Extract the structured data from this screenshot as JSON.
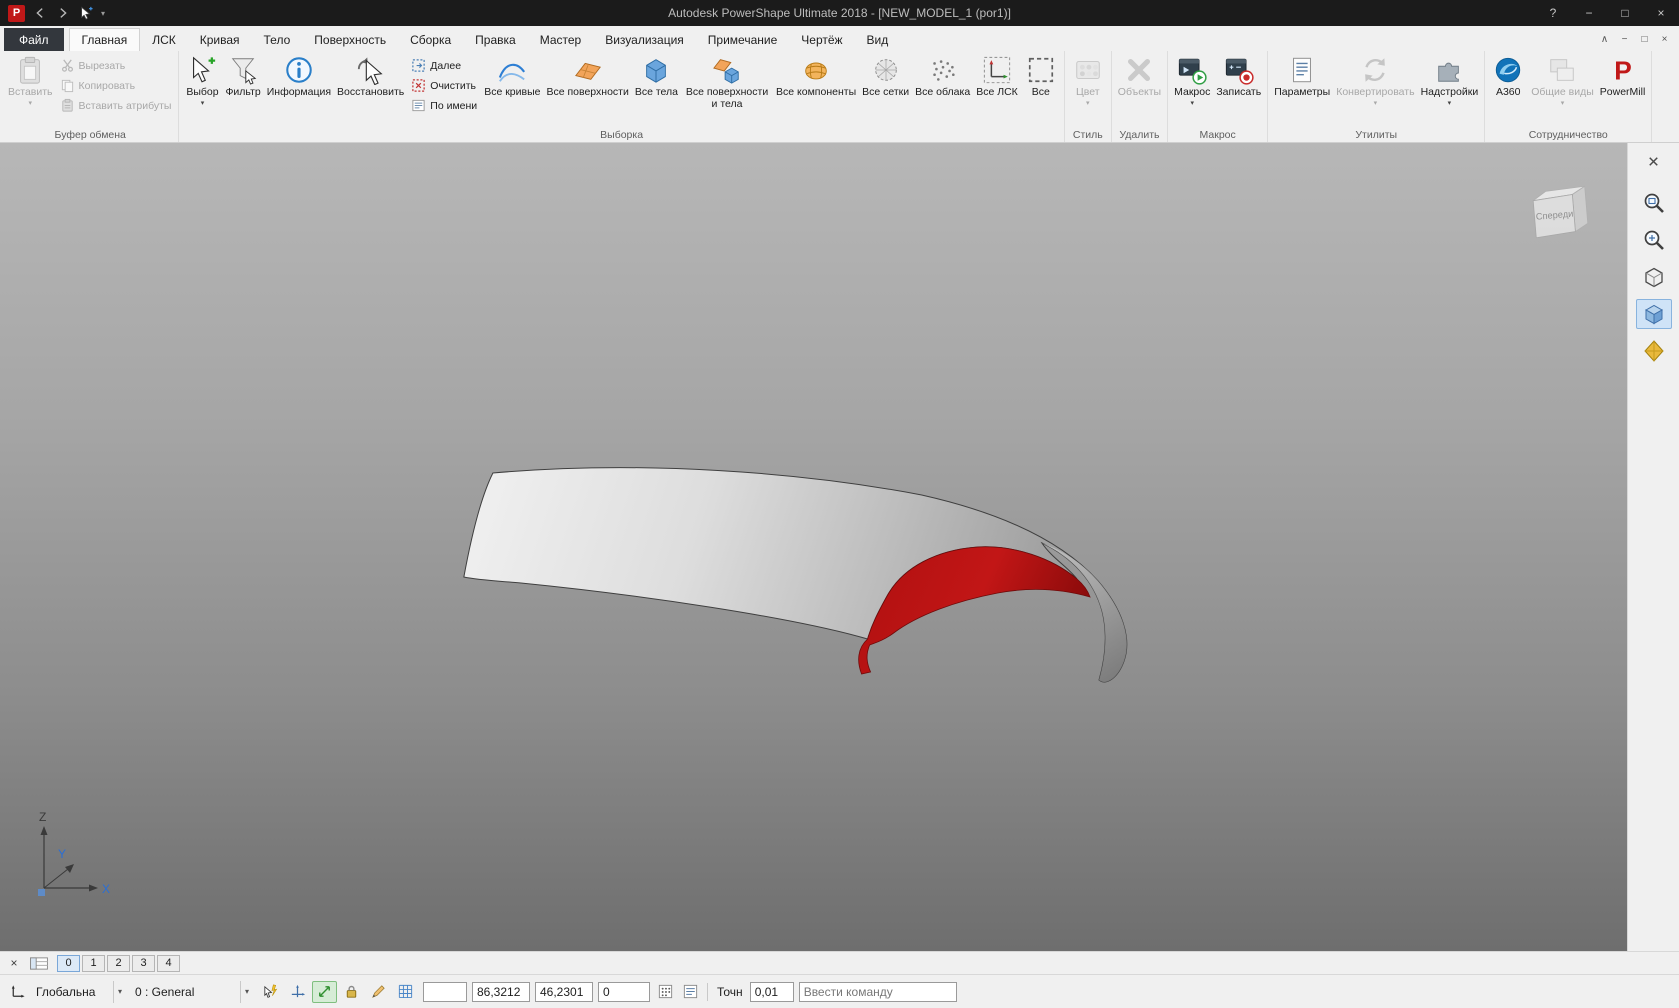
{
  "titlebar": {
    "title": "Autodesk PowerShape Ultimate 2018 - [NEW_MODEL_1 (por1)]",
    "logo_letter": "P",
    "controls": [
      {
        "name": "help-button",
        "glyph": "?"
      },
      {
        "name": "minimize-button",
        "glyph": "−"
      },
      {
        "name": "maximize-button",
        "glyph": "□"
      },
      {
        "name": "close-button",
        "glyph": "×"
      }
    ]
  },
  "tabs": {
    "file": "Файл",
    "active": "Главная",
    "items": [
      "Главная",
      "ЛСК",
      "Кривая",
      "Тело",
      "Поверхность",
      "Сборка",
      "Правка",
      "Мастер",
      "Визуализация",
      "Примечание",
      "Чертёж",
      "Вид"
    ],
    "window_controls": [
      {
        "name": "ribbon-collapse-button",
        "glyph": "∧"
      },
      {
        "name": "doc-minimize-button",
        "glyph": "−"
      },
      {
        "name": "doc-restore-button",
        "glyph": "□"
      },
      {
        "name": "doc-close-button",
        "glyph": "×"
      }
    ]
  },
  "ribbon": {
    "groups": [
      {
        "label": "Буфер обмена",
        "items": [
          {
            "name": "paste-button",
            "label": "Вставить",
            "icon": "paste-icon",
            "size": "big",
            "enabled": false,
            "arrow": true
          },
          {
            "name": "cut-button",
            "label": "Вырезать",
            "icon": "cut-icon",
            "size": "small",
            "enabled": false
          },
          {
            "name": "copy-button",
            "label": "Копировать",
            "icon": "copy-icon",
            "size": "small",
            "enabled": false
          },
          {
            "name": "paste-attributes-button",
            "label": "Вставить атрибуты",
            "icon": "paste-attributes-icon",
            "size": "small",
            "enabled": false
          }
        ]
      },
      {
        "label": "Выборка",
        "items": [
          {
            "name": "select-button",
            "label": "Выбор",
            "icon": "select-icon",
            "size": "big",
            "arrow": true
          },
          {
            "name": "filter-button",
            "label": "Фильтр",
            "icon": "filter-icon",
            "size": "big"
          },
          {
            "name": "info-button",
            "label": "Информация",
            "icon": "info-icon",
            "size": "big"
          },
          {
            "name": "restore-button",
            "label": "Восстановить",
            "icon": "restore-icon",
            "size": "big"
          },
          {
            "name": "next-button",
            "label": "Далее",
            "icon": "next-icon",
            "size": "small"
          },
          {
            "name": "clear-button",
            "label": "Очистить",
            "icon": "clear-icon",
            "size": "small"
          },
          {
            "name": "by-name-button",
            "label": "По имени",
            "icon": "by-name-icon",
            "size": "small"
          },
          {
            "name": "all-curves-button",
            "label": "Все кривые",
            "icon": "all-curves-icon",
            "size": "big"
          },
          {
            "name": "all-surfaces-button",
            "label": "Все поверхности",
            "icon": "all-surfaces-icon",
            "size": "big"
          },
          {
            "name": "all-solids-button",
            "label": "Все тела",
            "icon": "all-solids-icon",
            "size": "big"
          },
          {
            "name": "all-surfaces-solids-button",
            "label": "Все поверхности и тела",
            "icon": "all-surfaces-solids-icon",
            "size": "big"
          },
          {
            "name": "all-components-button",
            "label": "Все компоненты",
            "icon": "all-components-icon",
            "size": "big"
          },
          {
            "name": "all-meshes-button",
            "label": "Все сетки",
            "icon": "all-meshes-icon",
            "size": "big"
          },
          {
            "name": "all-clouds-button",
            "label": "Все облака",
            "icon": "all-clouds-icon",
            "size": "big"
          },
          {
            "name": "all-wcs-button",
            "label": "Все ЛСК",
            "icon": "all-wcs-icon",
            "size": "big"
          },
          {
            "name": "all-button",
            "label": "Все",
            "icon": "all-icon",
            "size": "big"
          }
        ]
      },
      {
        "label": "Стиль",
        "items": [
          {
            "name": "color-button",
            "label": "Цвет",
            "icon": "color-icon",
            "size": "big",
            "enabled": false,
            "arrow": true
          }
        ]
      },
      {
        "label": "Удалить",
        "items": [
          {
            "name": "delete-objects-button",
            "label": "Объекты",
            "icon": "delete-objects-icon",
            "size": "big",
            "enabled": false
          }
        ]
      },
      {
        "label": "Макрос",
        "items": [
          {
            "name": "macro-button",
            "label": "Макрос",
            "icon": "macro-icon",
            "size": "big",
            "arrow": true
          },
          {
            "name": "record-button",
            "label": "Записать",
            "icon": "record-icon",
            "size": "big"
          }
        ]
      },
      {
        "label": "Утилиты",
        "items": [
          {
            "name": "parameters-button",
            "label": "Параметры",
            "icon": "parameters-icon",
            "size": "big"
          },
          {
            "name": "convert-button",
            "label": "Конвертировать",
            "icon": "convert-icon",
            "size": "big",
            "enabled": false,
            "arrow": true
          },
          {
            "name": "addins-button",
            "label": "Надстройки",
            "icon": "addins-icon",
            "size": "big",
            "arrow": true
          }
        ]
      },
      {
        "label": "Сотрудничество",
        "items": [
          {
            "name": "a360-button",
            "label": "A360",
            "icon": "a360-icon",
            "size": "big"
          },
          {
            "name": "shared-views-button",
            "label": "Общие виды",
            "icon": "shared-views-icon",
            "size": "big",
            "enabled": false,
            "arrow": true
          },
          {
            "name": "powermill-button",
            "label": "PowerMill",
            "icon": "powermill-icon",
            "size": "big"
          }
        ]
      }
    ]
  },
  "viewport": {
    "viewcube_label": "Спереди",
    "axis_labels": {
      "x": "X",
      "y": "Y",
      "z": "Z"
    }
  },
  "right_toolbar": {
    "items": [
      {
        "name": "viewport-close-button",
        "icon": "close-x-icon",
        "first": true
      },
      {
        "name": "zoom-window-button",
        "icon": "zoom-window-icon"
      },
      {
        "name": "zoom-button",
        "icon": "zoom-icon"
      },
      {
        "name": "wireframe-view-button",
        "icon": "wireframe-cube-icon"
      },
      {
        "name": "shaded-view-button",
        "icon": "shaded-cube-icon",
        "active": true
      },
      {
        "name": "render-style-button",
        "icon": "render-style-icon"
      }
    ]
  },
  "levels_bar": {
    "close_glyph": "×",
    "buttons": [
      "0",
      "1",
      "2",
      "3",
      "4"
    ],
    "active": "0"
  },
  "command_bar": {
    "workplane": {
      "value": "Глобальна"
    },
    "level": {
      "value": "0  : General"
    },
    "toggles": [
      {
        "name": "intelligent-cursor-button",
        "icon": "cursor-flash-icon"
      },
      {
        "name": "position-button",
        "icon": "axes-icon"
      },
      {
        "name": "relative-mode-button",
        "icon": "relative-icon",
        "active": true
      },
      {
        "name": "lock-button",
        "icon": "lock-icon"
      },
      {
        "name": "item-appearance-button",
        "icon": "pencil-icon"
      },
      {
        "name": "grid-button",
        "icon": "grid-icon"
      }
    ],
    "coords": {
      "x": "86,3212",
      "y": "46,2301",
      "z": "0"
    },
    "tolerance_label": "Точн",
    "tolerance": "0,01",
    "command_placeholder": "Ввести команду"
  }
}
